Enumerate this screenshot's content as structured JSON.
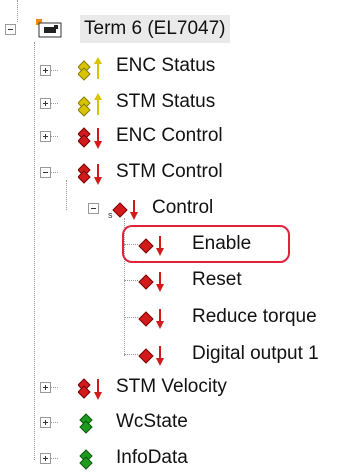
{
  "tree": {
    "root": {
      "label": "Term 6 (EL7047)"
    },
    "items": [
      {
        "label": "ENC Status",
        "icon": "input-yellow-arrow-up-icon"
      },
      {
        "label": "STM Status",
        "icon": "input-yellow-arrow-up-icon"
      },
      {
        "label": "ENC Control",
        "icon": "output-red-arrow-down-icon"
      },
      {
        "label": "STM Control",
        "icon": "output-red-arrow-down-icon"
      },
      {
        "label": "Control",
        "icon": "output-red-arrow-down-icon"
      },
      {
        "label": "Enable",
        "icon": "output-red-arrow-down-icon"
      },
      {
        "label": "Reset",
        "icon": "output-red-arrow-down-icon"
      },
      {
        "label": "Reduce torque",
        "icon": "output-red-arrow-down-icon"
      },
      {
        "label": "Digital output 1",
        "icon": "output-red-arrow-down-icon"
      },
      {
        "label": "STM Velocity",
        "icon": "output-red-arrow-down-icon"
      },
      {
        "label": "WcState",
        "icon": "green-input-icon"
      },
      {
        "label": "InfoData",
        "icon": "green-input-icon"
      }
    ]
  },
  "colors": {
    "highlight": "#e0223a",
    "input_arrow": "#d8c400",
    "output_arrow": "#d21a1a",
    "green": "#1e9a1e"
  }
}
